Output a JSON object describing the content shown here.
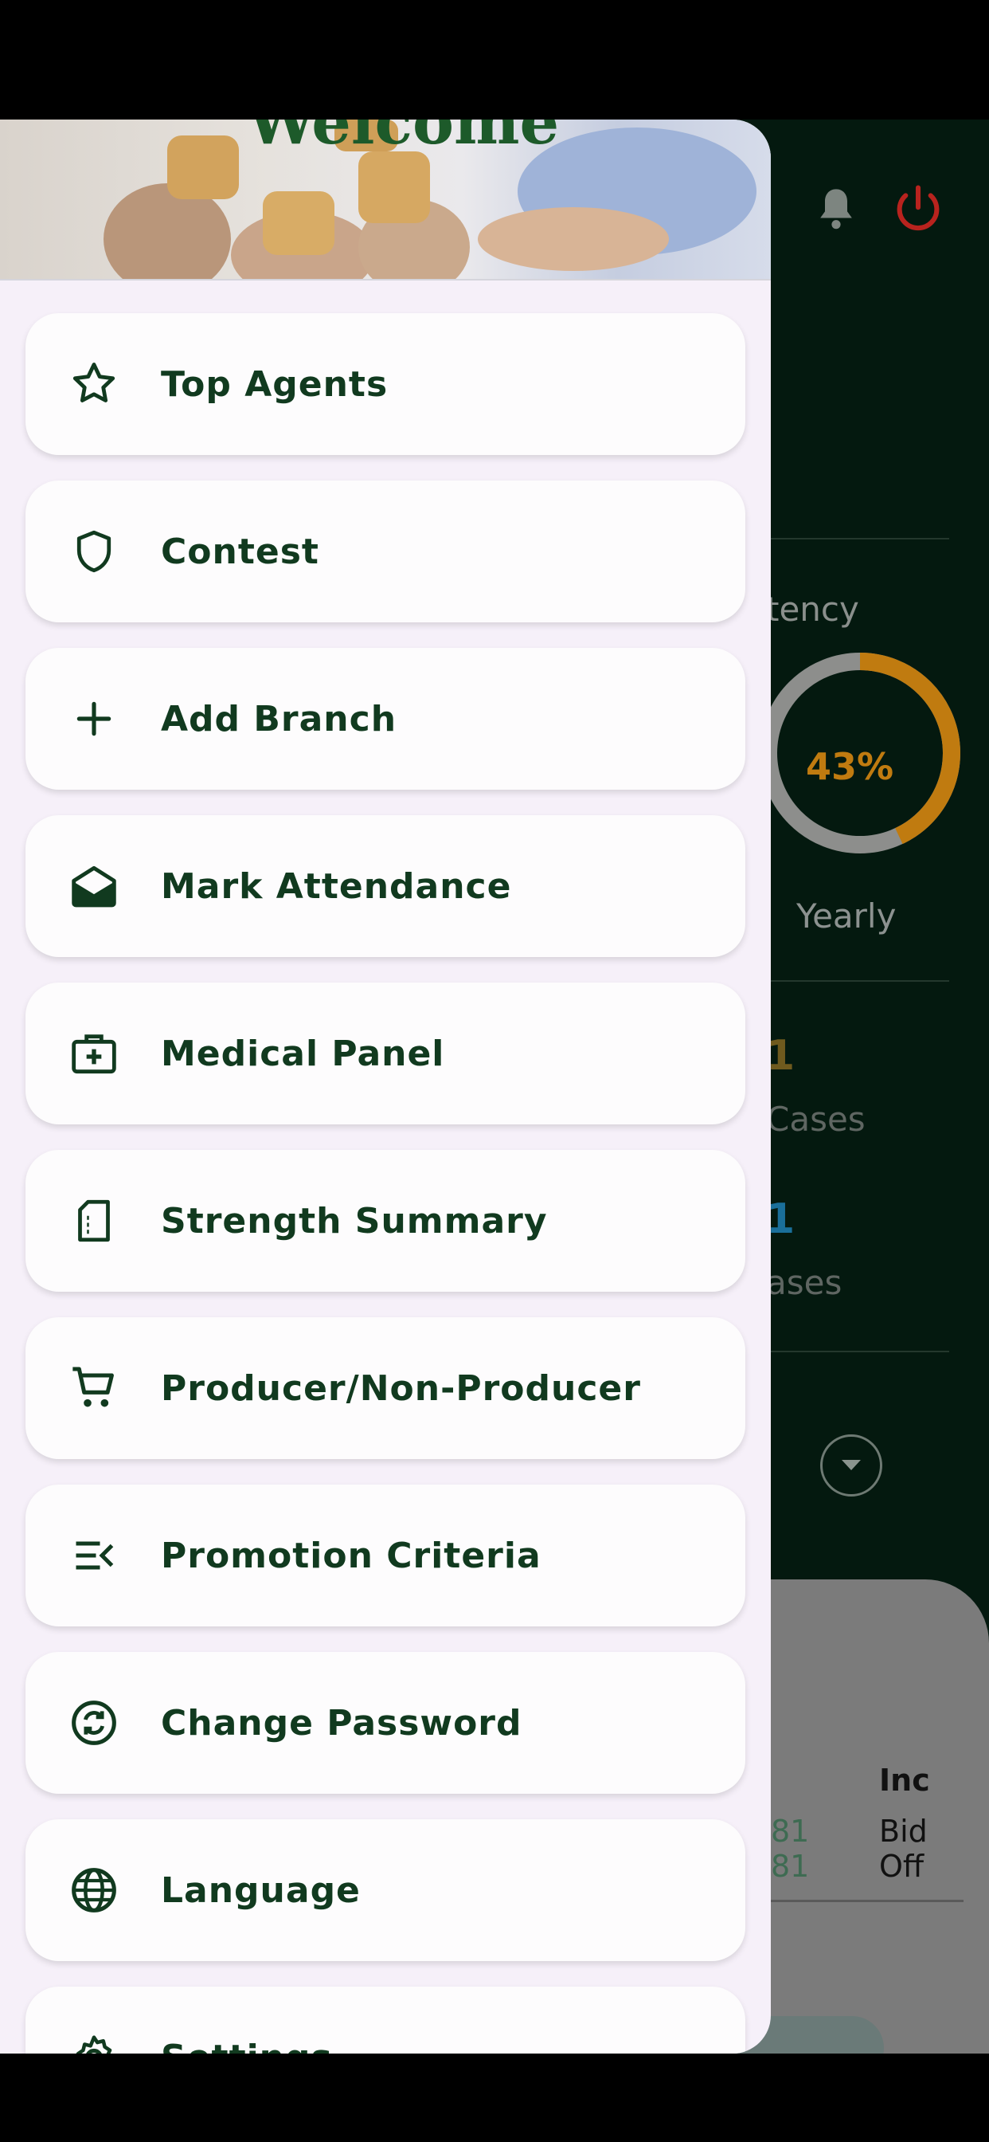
{
  "drawer": {
    "header_title": "Welcome",
    "items": [
      {
        "label": "Top Agents",
        "icon": "star-outline-icon"
      },
      {
        "label": "Contest",
        "icon": "shield-icon"
      },
      {
        "label": "Add Branch",
        "icon": "plus-icon"
      },
      {
        "label": "Mark Attendance",
        "icon": "mail-open-icon"
      },
      {
        "label": "Medical Panel",
        "icon": "medical-kit-icon"
      },
      {
        "label": "Strength Summary",
        "icon": "document-icon"
      },
      {
        "label": "Producer/Non-Producer",
        "icon": "shopping-cart-icon"
      },
      {
        "label": "Promotion Criteria",
        "icon": "list-collapse-icon"
      },
      {
        "label": "Change Password",
        "icon": "refresh-circle-icon"
      },
      {
        "label": "Language",
        "icon": "globe-icon"
      },
      {
        "label": "Settings",
        "icon": "gear-icon"
      }
    ]
  },
  "background": {
    "persistency_fragment": "tency",
    "donut_percent": "43%",
    "donut_value": 0.43,
    "donut_caption": "Yearly",
    "stat1_value": "1",
    "stat1_label": "Cases",
    "stat2_value": "1",
    "stat2_label": "ases",
    "sheet_col_header": "Inc",
    "sheet_row1_num": "81",
    "sheet_row1_text": "Bid",
    "sheet_row2_num": "81",
    "sheet_row2_text": "Off"
  },
  "colors": {
    "accent_green": "#113a1f",
    "donut_orange": "#c07b10",
    "power_red": "#b8231e"
  }
}
